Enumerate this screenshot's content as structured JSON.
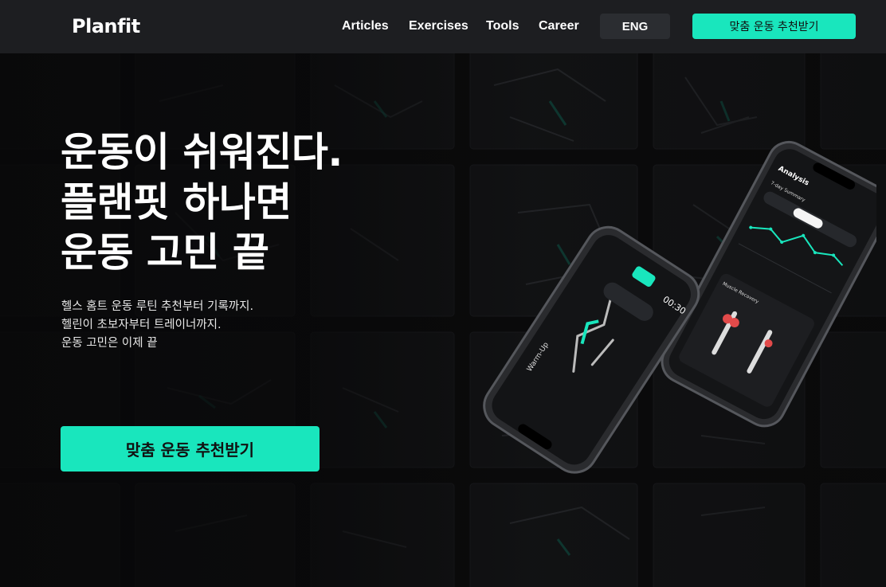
{
  "header": {
    "logo": "Planfit",
    "nav": [
      {
        "label": "Articles"
      },
      {
        "label": "Exercises"
      },
      {
        "label": "Tools"
      },
      {
        "label": "Career"
      }
    ],
    "language_label": "ENG",
    "cta_label": "맞춤 운동 추천받기"
  },
  "hero": {
    "headline_lines": [
      "운동이 쉬워진다.",
      "플랜핏 하나면",
      "운동 고민 끝"
    ],
    "sub_lines": [
      "헬스 홈트 운동 루틴 추천부터 기록까지.",
      "헬린이 초보자부터 트레이너까지.",
      "운동 고민은 이제 끝"
    ],
    "cta_label": "맞춤 운동 추천받기"
  },
  "phone_front": {
    "time": "00:30",
    "screen_title": "Warm-Up"
  },
  "phone_back": {
    "title": "Analysis",
    "summary_label": "7-day Summary",
    "section_label": "Muscle Recovery"
  },
  "colors": {
    "accent": "#19e6bd",
    "header_bg": "#1d1e21",
    "lang_bg": "#2b2d31",
    "hero_bg": "#0b0b0c"
  }
}
